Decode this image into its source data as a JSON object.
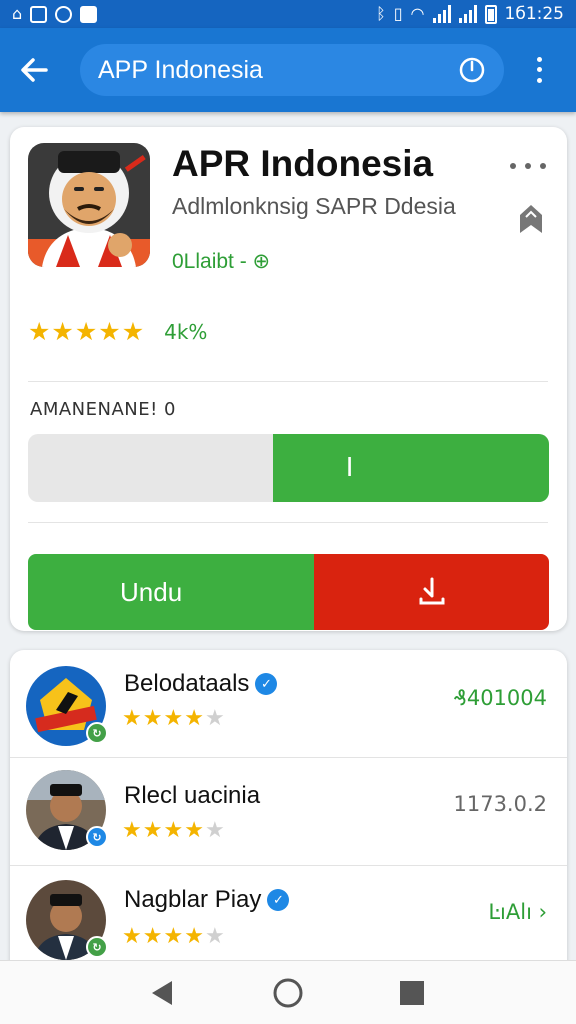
{
  "status_bar": {
    "time": "1б1:25",
    "left_icons": [
      "notification-icon",
      "image-icon",
      "circle-app-icon",
      "mail-icon"
    ],
    "right_icons": [
      "bluetooth-icon",
      "vibrate-icon",
      "wifi-icon",
      "signal-icon",
      "signal-icon",
      "battery-icon"
    ]
  },
  "app_bar": {
    "search_text": "APP Indonesia",
    "color": "#1976d2"
  },
  "app": {
    "title": "APR Indonesia",
    "subtitle": "Adlmlonknsig SAPR Ddesia",
    "meta": "0Llaibt - ⊕",
    "rating_stars": 5,
    "rating_count": "4k%",
    "section_label": "AMANENANE! 0",
    "progress_fraction": 0.53,
    "progress_text": "I",
    "download_label": "Undu",
    "accent_green": "#3daf40",
    "accent_red": "#d9230f"
  },
  "list": [
    {
      "name": "Belodataals",
      "verified": true,
      "stars": 4,
      "value": "₰401004",
      "value_green": true,
      "badge_color": "#43a047"
    },
    {
      "name": "Rlecl uacinia",
      "verified": false,
      "stars": 4,
      "value": "1173.0.2",
      "value_green": false,
      "badge_color": "#1e88e5"
    },
    {
      "name": "Nagblar Piay",
      "verified": true,
      "stars": 4,
      "value": "ĿıAlı ›",
      "value_green": true,
      "badge_color": "#43a047"
    }
  ],
  "nav": [
    "back-nav",
    "home-nav",
    "recents-nav"
  ]
}
